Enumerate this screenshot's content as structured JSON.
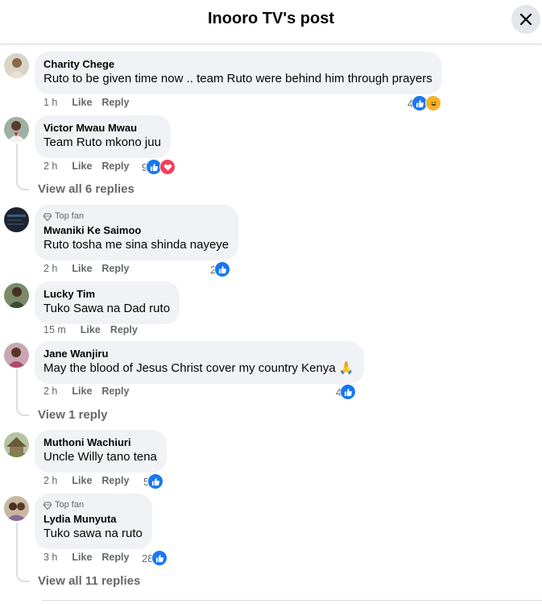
{
  "header": {
    "title": "Inooro TV's post"
  },
  "comments": [
    {
      "name": "Charity Chege",
      "text": "Ruto to be given time now .. team Ruto were behind him through prayers",
      "time": "1 h",
      "like": "Like",
      "reply": "Reply",
      "count": "4",
      "reactions": [
        "like",
        "haha"
      ]
    },
    {
      "name": "Victor Mwau Mwau",
      "text": "Team Ruto mkono juu",
      "time": "2 h",
      "like": "Like",
      "reply": "Reply",
      "count": "9",
      "reactions": [
        "like",
        "love"
      ],
      "view_replies": "View all 6 replies"
    },
    {
      "badge": "Top fan",
      "name": "Mwaniki Ke Saimoo",
      "text": "Ruto tosha me sina shinda nayeye",
      "time": "2 h",
      "like": "Like",
      "reply": "Reply",
      "count": "2",
      "reactions": [
        "like"
      ]
    },
    {
      "name": "Lucky Tim",
      "text": "Tuko Sawa na Dad ruto",
      "time": "15 m",
      "like": "Like",
      "reply": "Reply"
    },
    {
      "name": "Jane Wanjiru",
      "text": "May the blood of Jesus Christ cover my country Kenya 🙏",
      "time": "2 h",
      "like": "Like",
      "reply": "Reply",
      "count": "4",
      "reactions": [
        "like"
      ],
      "view_replies": "View 1 reply"
    },
    {
      "name": "Muthoni Wachiuri",
      "text": "Uncle Willy tano tena",
      "time": "2 h",
      "like": "Like",
      "reply": "Reply",
      "count": "5",
      "reactions": [
        "like"
      ]
    },
    {
      "badge": "Top fan",
      "name": "Lydia Munyuta",
      "text": "Tuko sawa na ruto",
      "time": "3 h",
      "like": "Like",
      "reply": "Reply",
      "count": "28",
      "reactions": [
        "like"
      ],
      "view_replies": "View all 11 replies"
    }
  ],
  "colors": {
    "accent": "#1877f2",
    "bubble": "#f0f2f5",
    "muted": "#65676b",
    "love": "#f33e58",
    "haha": "#f7b125"
  }
}
